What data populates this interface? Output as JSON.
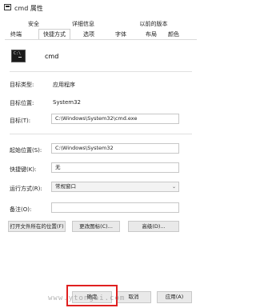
{
  "window": {
    "title": "cmd 属性"
  },
  "tabs": [
    {
      "label": "安全"
    },
    {
      "label": "详细信息"
    },
    {
      "label": "以前的版本"
    },
    {
      "label": "快捷方式"
    },
    {
      "label": "选项"
    },
    {
      "label": "字体"
    },
    {
      "label": "布局"
    },
    {
      "label": "颜色"
    },
    {
      "label": "终端"
    }
  ],
  "header": {
    "app_name": "cmd"
  },
  "fields": {
    "target_type": {
      "label": "目标类型:",
      "value": "应用程序"
    },
    "target_location": {
      "label": "目标位置:",
      "value": "System32"
    },
    "target": {
      "label": "目标(T):",
      "value": "C:\\Windows\\System32\\cmd.exe"
    },
    "start_in": {
      "label": "起始位置(S):",
      "value": "C:\\Windows\\System32"
    },
    "shortcut_key": {
      "label": "快捷键(K):",
      "value": "无"
    },
    "run": {
      "label": "运行方式(R):",
      "value": "常规窗口"
    },
    "comment": {
      "label": "备注(O):",
      "value": ""
    }
  },
  "buttons": {
    "open_location": "打开文件所在的位置(F)",
    "change_icon": "更改图标(C)...",
    "advanced": "高级(D)...",
    "ok": "确定",
    "cancel": "取消",
    "apply": "应用(A)"
  },
  "watermark": "www.ytongai.com",
  "colors": {
    "highlight": "#e02020"
  }
}
